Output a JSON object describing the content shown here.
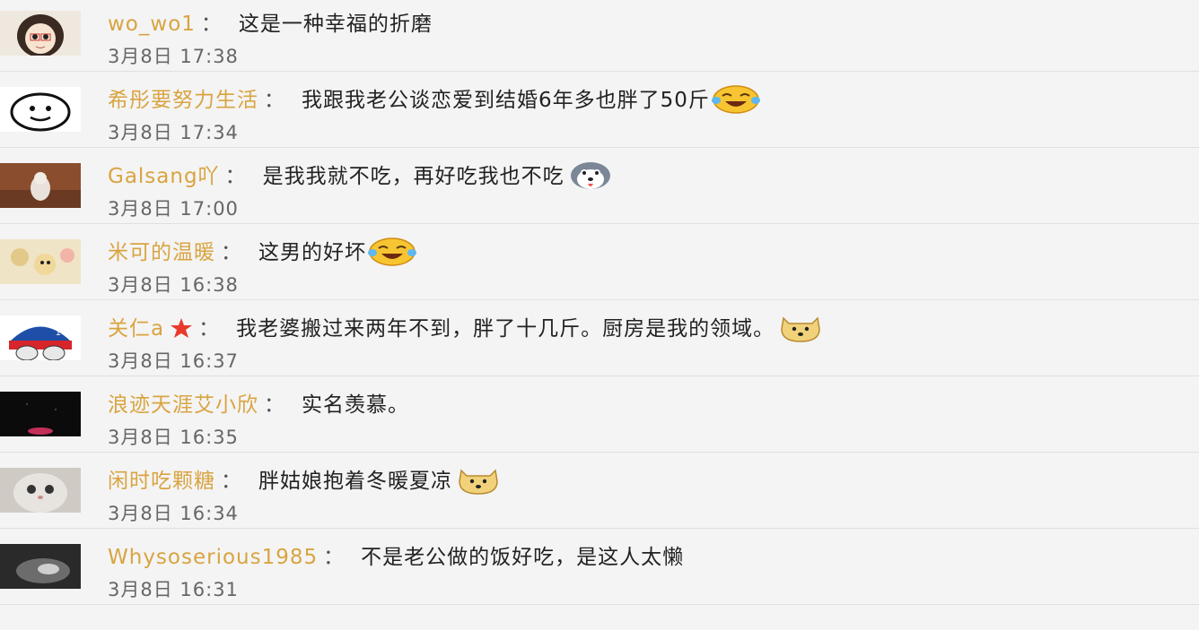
{
  "comments": [
    {
      "username": "wo_wo1",
      "colon": "：",
      "text": "这是一种幸福的折磨",
      "time": "3月8日 17:38",
      "emoji": null
    },
    {
      "username": "希彤要努力生活",
      "colon": "：",
      "text": "我跟我老公谈恋爱到结婚6年多也胖了50斤",
      "time": "3月8日 17:34",
      "emoji": "laugh-cry-emoji-icon"
    },
    {
      "username": "Galsang吖",
      "colon": "：",
      "text": "是我我就不吃，再好吃我也不吃",
      "time": "3月8日 17:00",
      "emoji": "husky-emoji-icon"
    },
    {
      "username": "米可的温暖",
      "colon": "：",
      "text": "这男的好坏",
      "time": "3月8日 16:38",
      "emoji": "laugh-cry-emoji-icon"
    },
    {
      "username": "关仁a",
      "colon": "：",
      "text": "我老婆搬过来两年不到，胖了十几斤。厨房是我的领域。",
      "time": "3月8日 16:37",
      "emoji": "doge-emoji-icon",
      "badge": "star-icon"
    },
    {
      "username": "浪迹天涯艾小欣",
      "colon": "：",
      "text": "实名羡慕。",
      "time": "3月8日 16:35",
      "emoji": null
    },
    {
      "username": "闲时吃颗糖",
      "colon": "：",
      "text": "胖姑娘抱着冬暖夏凉",
      "time": "3月8日 16:34",
      "emoji": "doge-emoji-icon"
    },
    {
      "username": "Whysoserious1985",
      "colon": "：",
      "text": "不是老公做的饭好吃，是这人太懒",
      "time": "3月8日 16:31",
      "emoji": null
    }
  ],
  "colors": {
    "username": "#d9a441",
    "text": "#222222",
    "time": "#666666",
    "background": "#f4f4f4"
  }
}
